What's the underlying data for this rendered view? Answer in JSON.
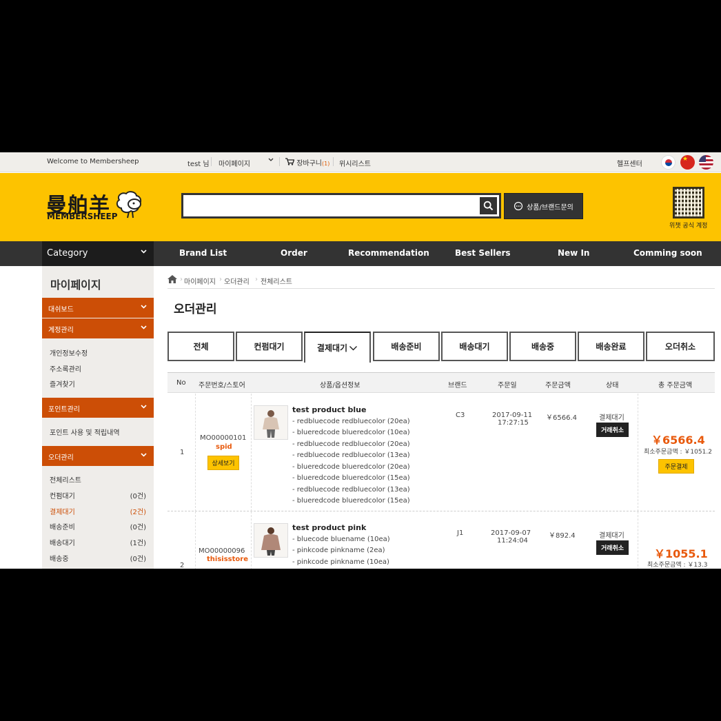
{
  "topbar": {
    "welcome": "Welcome to Membersheep",
    "user": "test 님",
    "mypage": "마이페이지",
    "cart": "장바구니",
    "cart_count": "(1)",
    "wishlist": "위시리스트",
    "help": "헬프센터"
  },
  "header": {
    "logo_cn": "曼舶羊",
    "logo_en": "MEMBERSHEEP",
    "search_placeholder": "",
    "inquiry_label": "상품/브랜드문의",
    "qr_label": "위챗 공식 계정"
  },
  "nav": {
    "category": "Category",
    "items": [
      "Brand List",
      "Order",
      "Recommendation",
      "Best Sellers",
      "New In",
      "Comming soon"
    ]
  },
  "sidebar": {
    "title": "마이페이지",
    "dashboard": "대쉬보드",
    "account": "계정관리",
    "account_items": [
      "개인정보수정",
      "주소록관리",
      "즐겨찾기"
    ],
    "points": "포인트관리",
    "points_items": [
      "포인트 사용 및 적립내역"
    ],
    "orders": "오더관리",
    "order_items": [
      {
        "label": "전체리스트",
        "count": ""
      },
      {
        "label": "컨펌대기",
        "count": "(0건)"
      },
      {
        "label": "결제대기",
        "count": "(2건)"
      },
      {
        "label": "배송준비",
        "count": "(0건)"
      },
      {
        "label": "배송대기",
        "count": "(1건)"
      },
      {
        "label": "배송중",
        "count": "(0건)"
      }
    ]
  },
  "breadcrumb": [
    "마이페이지",
    "오더관리",
    "전체리스트"
  ],
  "page_title": "오더관리",
  "tabs": [
    "전체",
    "컨펌대기",
    "결제대기",
    "배송준비",
    "배송대기",
    "배송중",
    "배송완료",
    "오더취소"
  ],
  "table": {
    "headers": [
      "No",
      "주문번호/스토어",
      "상품/옵션정보",
      "브랜드",
      "주문일",
      "주문금액",
      "상태",
      "총 주문금액"
    ],
    "rows": [
      {
        "no": "1",
        "order_no": "MO00000101",
        "store": "spid",
        "detail_btn": "상세보기",
        "product": "test product blue",
        "options": [
          "- redbluecode redbluecolor (20ea)",
          "- blueredcode blueredcolor (10ea)",
          "- redbluecode redbluecolor (20ea)",
          "- redbluecode redbluecolor (13ea)",
          "- blueredcode blueredcolor (20ea)",
          "- blueredcode blueredcolor (15ea)",
          "- redbluecode redbluecolor (13ea)",
          "- blueredcode blueredcolor (15ea)"
        ],
        "brand": "C3",
        "date": "2017-09-11",
        "time": "17:27:15",
        "amount": "￥6566.4",
        "status": "결제대기",
        "cancel_btn": "거래취소",
        "total": "￥6566.4",
        "min_total": "최소주문금액 : ￥1051.2",
        "pay_btn": "주문결제"
      },
      {
        "no": "2",
        "order_no": "MO00000096",
        "store": "thisisstore",
        "product": "test product pink",
        "options": [
          "- bluecode bluename (10ea)",
          "- pinkcode pinkname (2ea)",
          "- pinkcode pinkname (10ea)"
        ],
        "brand": "J1",
        "date": "2017-09-07",
        "time": "11:24:04",
        "amount": "￥892.4",
        "status": "결제대기",
        "cancel_btn": "거래취소",
        "total": "￥1055.1",
        "min_total": "최소주문금액 : ￥13.3"
      }
    ]
  },
  "colors": {
    "brand_yellow": "#fdc300",
    "accent_orange": "#cc4e06",
    "price_orange": "#e8590c",
    "dark": "#333333"
  }
}
